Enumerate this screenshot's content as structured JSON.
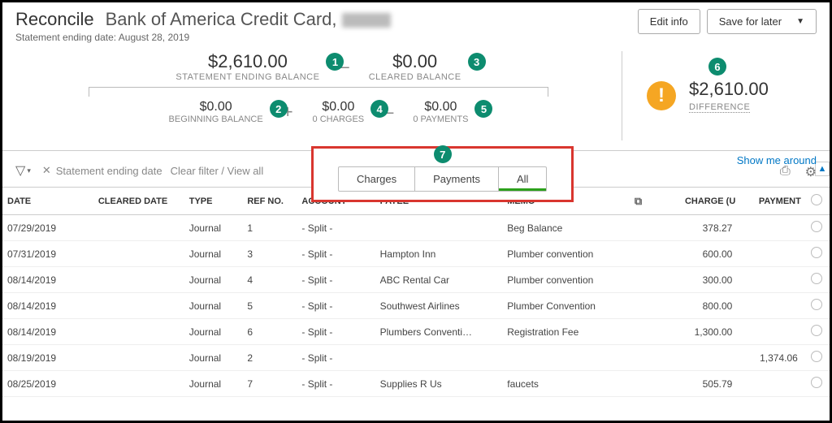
{
  "header": {
    "title": "Reconcile",
    "bank": "Bank of America Credit Card,",
    "subtitle": "Statement ending date: August 28, 2019",
    "edit_btn": "Edit info",
    "save_btn": "Save for later"
  },
  "summary": {
    "ending": {
      "amount": "$2,610.00",
      "label": "STATEMENT ENDING BALANCE"
    },
    "cleared": {
      "amount": "$0.00",
      "label": "CLEARED BALANCE"
    },
    "beginning": {
      "amount": "$0.00",
      "label": "BEGINNING BALANCE"
    },
    "charges": {
      "amount": "$0.00",
      "label": "0 CHARGES"
    },
    "payments": {
      "amount": "$0.00",
      "label": "0 PAYMENTS"
    },
    "difference": {
      "amount": "$2,610.00",
      "label": "DIFFERENCE"
    }
  },
  "badges": {
    "b1": "1",
    "b2": "2",
    "b3": "3",
    "b4": "4",
    "b5": "5",
    "b6": "6",
    "b7": "7"
  },
  "toolbar": {
    "chip": "Statement ending date",
    "hint": "Clear filter / View all",
    "show_link": "Show me around",
    "tabs": {
      "charges": "Charges",
      "payments": "Payments",
      "all": "All"
    }
  },
  "columns": {
    "date": "DATE",
    "cleared": "CLEARED DATE",
    "type": "TYPE",
    "ref": "REF NO.",
    "account": "ACCOUNT",
    "payee": "PAYEE",
    "memo": "MEMO",
    "charge": "CHARGE (U",
    "payment": "PAYMENT"
  },
  "rows": [
    {
      "date": "07/29/2019",
      "cleared": "",
      "type": "Journal",
      "ref": "1",
      "account": "- Split -",
      "payee": "",
      "memo": "Beg Balance",
      "charge": "378.27",
      "payment": ""
    },
    {
      "date": "07/31/2019",
      "cleared": "",
      "type": "Journal",
      "ref": "3",
      "account": "- Split -",
      "payee": "Hampton Inn",
      "memo": "Plumber convention",
      "charge": "600.00",
      "payment": ""
    },
    {
      "date": "08/14/2019",
      "cleared": "",
      "type": "Journal",
      "ref": "4",
      "account": "- Split -",
      "payee": "ABC Rental Car",
      "memo": "Plumber convention",
      "charge": "300.00",
      "payment": ""
    },
    {
      "date": "08/14/2019",
      "cleared": "",
      "type": "Journal",
      "ref": "5",
      "account": "- Split -",
      "payee": "Southwest Airlines",
      "memo": "Plumber Convention",
      "charge": "800.00",
      "payment": ""
    },
    {
      "date": "08/14/2019",
      "cleared": "",
      "type": "Journal",
      "ref": "6",
      "account": "- Split -",
      "payee": "Plumbers Conventi…",
      "memo": "Registration Fee",
      "charge": "1,300.00",
      "payment": ""
    },
    {
      "date": "08/19/2019",
      "cleared": "",
      "type": "Journal",
      "ref": "2",
      "account": "- Split -",
      "payee": "",
      "memo": "",
      "charge": "",
      "payment": "1,374.06"
    },
    {
      "date": "08/25/2019",
      "cleared": "",
      "type": "Journal",
      "ref": "7",
      "account": "- Split -",
      "payee": "Supplies R Us",
      "memo": "faucets",
      "charge": "505.79",
      "payment": ""
    }
  ]
}
